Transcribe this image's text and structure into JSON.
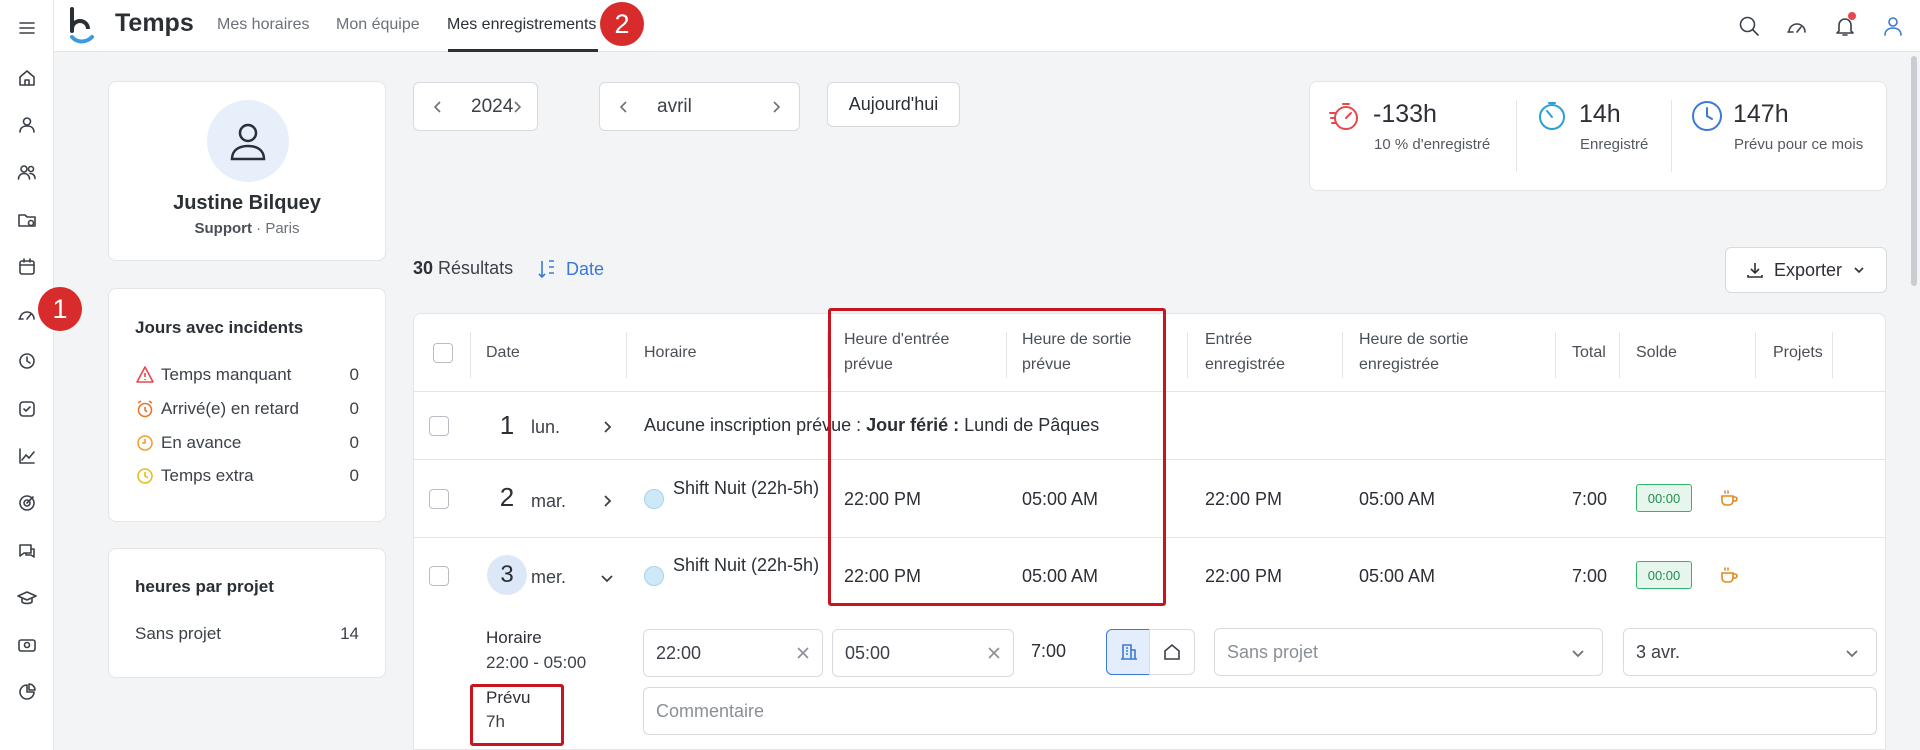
{
  "app": {
    "title": "Temps"
  },
  "nav": {
    "tabs": [
      {
        "label": "Mes horaires",
        "active": false
      },
      {
        "label": "Mon équipe",
        "active": false
      },
      {
        "label": "Mes enregistrements",
        "active": true
      }
    ]
  },
  "annotations": {
    "marker1": "1",
    "marker2": "2"
  },
  "sidebar": {
    "icons": [
      "menu-icon",
      "home-icon",
      "user-icon",
      "users-icon",
      "folder-icon",
      "calendar-icon",
      "speedometer-icon",
      "clock-icon",
      "checkbox-icon",
      "chart-line-icon",
      "target-icon",
      "chat-icon",
      "graduation-icon",
      "id-card-icon",
      "pie-chart-icon"
    ]
  },
  "topbar": {
    "icons": [
      "search-icon",
      "speedometer-icon",
      "bell-icon",
      "user-icon"
    ],
    "notification_dot_color": "#e5484d"
  },
  "profile": {
    "name": "Justine Bilquey",
    "team": "Support",
    "separator": " · ",
    "location": "Paris"
  },
  "incidents": {
    "title": "Jours avec incidents",
    "items": [
      {
        "label": "Temps manquant",
        "value": "0",
        "color": "#e5484d",
        "icon": "warning-triangle-icon"
      },
      {
        "label": "Arrivé(e) en retard",
        "value": "0",
        "color": "#e8762b",
        "icon": "alarm-clock-icon"
      },
      {
        "label": "En avance",
        "value": "0",
        "color": "#f0a030",
        "icon": "clock-icon"
      },
      {
        "label": "Temps extra",
        "value": "0",
        "color": "#e0c020",
        "icon": "clock-icon"
      }
    ]
  },
  "projects_card": {
    "title": "heures par projet",
    "items": [
      {
        "label": "Sans projet",
        "value": "14"
      }
    ]
  },
  "filters": {
    "year": "2024",
    "month": "avril",
    "today_label": "Aujourd'hui"
  },
  "stats": [
    {
      "value": "-133h",
      "label": "10 % d'enregistré",
      "color": "#e5484d",
      "icon": "stopwatch-icon"
    },
    {
      "value": "14h",
      "label": "Enregistré",
      "color": "#2aa0d8",
      "icon": "timer-icon"
    },
    {
      "value": "147h",
      "label": "Prévu pour ce mois",
      "color": "#3a79d6",
      "icon": "clock-icon"
    }
  ],
  "results": {
    "count": "30",
    "label": "Résultats",
    "sort_label": "Date",
    "export_label": "Exporter"
  },
  "table": {
    "headers": {
      "date": "Date",
      "horaire": "Horaire",
      "planned_in": [
        "Heure d'entrée",
        "prévue"
      ],
      "planned_out": [
        "Heure de sortie",
        "prévue"
      ],
      "recorded_in": [
        "Entrée",
        "enregistrée"
      ],
      "recorded_out": [
        "Heure de sortie",
        "enregistrée"
      ],
      "total": "Total",
      "solde": "Solde",
      "projets": "Projets"
    },
    "rows": [
      {
        "day": "1",
        "dayname": "lun.",
        "note_prefix": "Aucune inscription prévue : ",
        "note_bold": "Jour férié :",
        "note_rest": " Lundi de Pâques"
      },
      {
        "day": "2",
        "dayname": "mar.",
        "shift": "Shift Nuit (22h-5h)",
        "planned_in": "22:00 PM",
        "planned_out": "05:00 AM",
        "recorded_in": "22:00 PM",
        "recorded_out": "05:00 AM",
        "total": "7:00",
        "solde": "00:00"
      },
      {
        "day": "3",
        "dayname": "mer.",
        "shift": "Shift Nuit (22h-5h)",
        "planned_in": "22:00 PM",
        "planned_out": "05:00 AM",
        "recorded_in": "22:00 PM",
        "recorded_out": "05:00 AM",
        "total": "7:00",
        "solde": "00:00"
      }
    ]
  },
  "detail": {
    "horaire_label": "Horaire",
    "horaire_value": "22:00 - 05:00",
    "prevu_label": "Prévu",
    "prevu_value": "7h",
    "start_time": "22:00",
    "end_time": "05:00",
    "duration": "7:00",
    "project_value": "Sans projet",
    "date_value": "3 avr.",
    "comment_placeholder": "Commentaire"
  }
}
